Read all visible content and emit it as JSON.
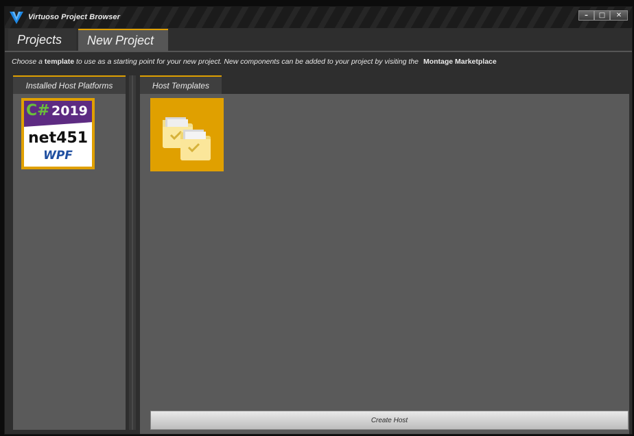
{
  "window": {
    "title": "Virtuoso Project Browser",
    "minimize_glyph": "–",
    "maximize_glyph": "□",
    "close_glyph": "✕"
  },
  "tabs": [
    {
      "label": "Projects",
      "selected": false
    },
    {
      "label": "New Project",
      "selected": true
    }
  ],
  "instructions": {
    "part1": "Choose a ",
    "bold1": "template",
    "part2": " to use as a starting point for your new project. New components can be added to your project by visiting the ",
    "bold2": "Montage Marketplace"
  },
  "left_panel": {
    "tab_label": "Installed Host Platforms",
    "platform": {
      "lang": "C#",
      "year": "2019",
      "framework": "net451",
      "ui": "WPF"
    }
  },
  "right_panel": {
    "tab_label": "Host Templates",
    "template_icon": "folder-copy-icon",
    "create_label": "Create Host"
  },
  "colors": {
    "accent": "#e0a000",
    "panel": "#5a5a5a",
    "badge_purple": "#5d2b82"
  }
}
